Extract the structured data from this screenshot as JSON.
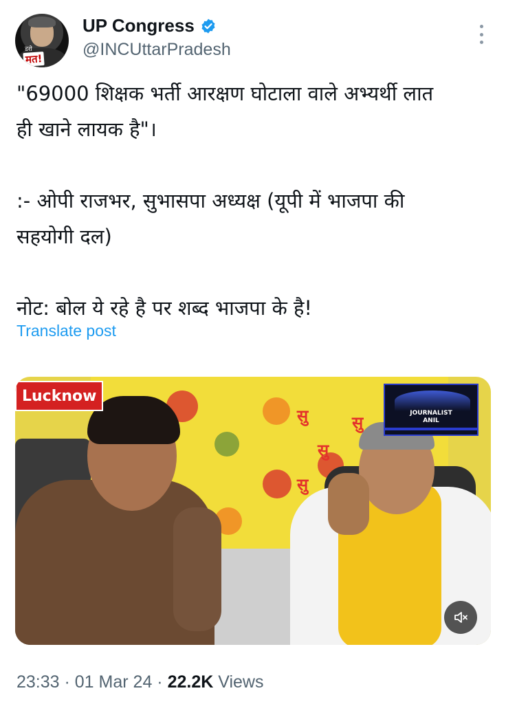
{
  "author": {
    "name": "UP Congress",
    "handle": "@INCUttarPradesh",
    "avatar_text_small": "डरो",
    "avatar_text_badge": "मत!",
    "verified_icon": "verified-badge-icon",
    "verified_color": "#1d9bf0"
  },
  "post": {
    "lines": [
      "\"69000 शिक्षक भर्ती आरक्षण घोटाला वाले अभ्यर्थी लात",
      "ही खाने लायक है\"।",
      "",
      ":- ओपी राजभर, सुभासपा अध्यक्ष (यूपी में भाजपा की",
      "सहयोगी दल)",
      "",
      "नोट: बोल ये रहे है पर शब्द भाजपा के है!"
    ],
    "translate_label": "Translate post"
  },
  "media": {
    "location_tag": "Lucknow",
    "overlay_logo_title": "JOURNALIST",
    "overlay_logo_sub": "ANIL",
    "mute_icon": "speaker-muted-icon"
  },
  "footer": {
    "time": "23:33",
    "separator1": " · ",
    "date": "01 Mar 24",
    "separator2": " · ",
    "views_count": "22.2K",
    "views_label": " Views"
  },
  "colors": {
    "link": "#1d9bf0",
    "secondary_text": "#536471",
    "primary_text": "#0f1419"
  }
}
